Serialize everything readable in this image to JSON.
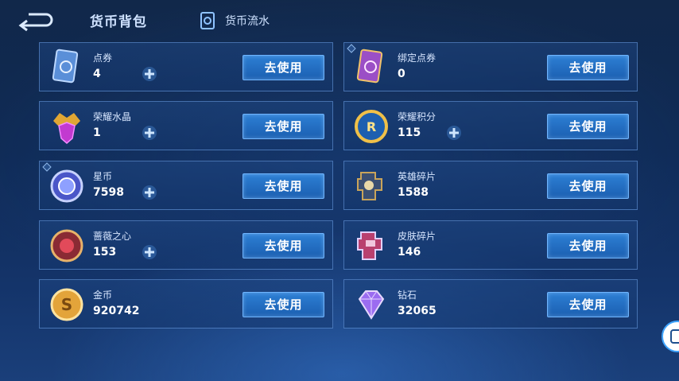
{
  "header": {
    "title": "货币背包",
    "flow_label": "货币流水"
  },
  "button_label": "去使用",
  "colors": {
    "accent": "#2d7fd4",
    "background": "#13305f"
  },
  "left_column": [
    {
      "name": "点券",
      "value": "4",
      "icon": "ticket-card-icon",
      "plus": true
    },
    {
      "name": "荣耀水晶",
      "value": "1",
      "icon": "glory-crystal-icon",
      "plus": true
    },
    {
      "name": "星币",
      "value": "7598",
      "icon": "star-coin-icon",
      "plus": true,
      "badge": true
    },
    {
      "name": "蔷薇之心",
      "value": "153",
      "icon": "rose-heart-icon",
      "plus": true
    },
    {
      "name": "金币",
      "value": "920742",
      "icon": "gold-coin-icon",
      "plus": false
    }
  ],
  "right_column": [
    {
      "name": "绑定点券",
      "value": "0",
      "icon": "bound-ticket-icon",
      "plus": false,
      "badge": true
    },
    {
      "name": "荣耀积分",
      "value": "115",
      "icon": "glory-points-icon",
      "plus": true
    },
    {
      "name": "英雄碎片",
      "value": "1588",
      "icon": "hero-fragment-icon",
      "plus": false
    },
    {
      "name": "皮肤碎片",
      "value": "146",
      "icon": "skin-fragment-icon",
      "plus": false
    },
    {
      "name": "钻石",
      "value": "32065",
      "icon": "diamond-icon",
      "plus": false
    }
  ]
}
